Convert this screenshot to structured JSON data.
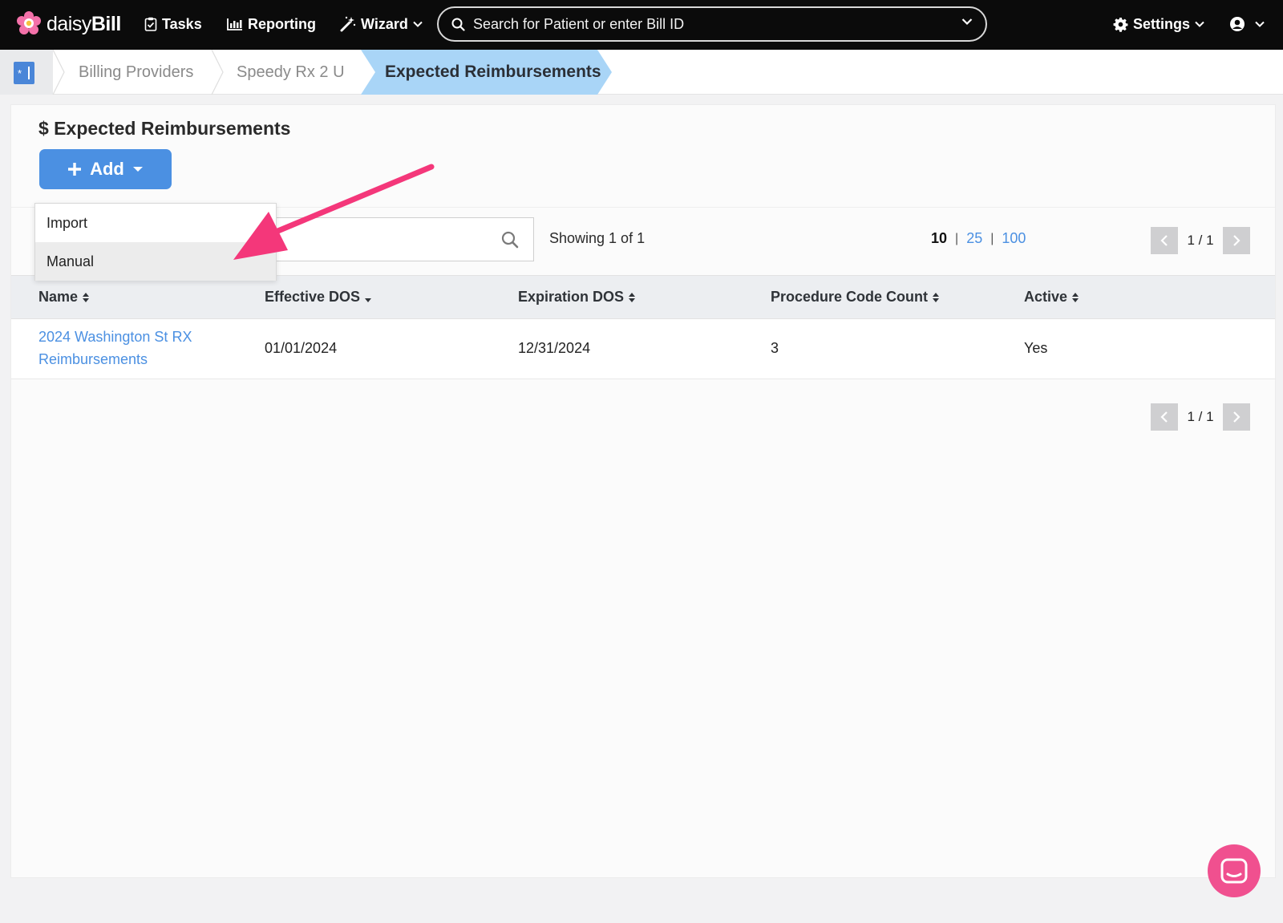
{
  "brand": {
    "logo_icon": "daisy-flower-icon",
    "name_light": "daisy",
    "name_bold": "Bill"
  },
  "nav": {
    "tasks": "Tasks",
    "reporting": "Reporting",
    "wizard": "Wizard",
    "search_placeholder": "Search for Patient or enter Bill ID",
    "settings": "Settings"
  },
  "breadcrumb": {
    "items": [
      "Billing Providers",
      "Speedy Rx 2 U"
    ],
    "current": "Expected Reimbursements"
  },
  "page": {
    "title": "$ Expected Reimbursements",
    "add_label": "Add"
  },
  "add_menu": {
    "items": [
      "Import",
      "Manual"
    ],
    "highlighted": "Manual"
  },
  "list": {
    "showing": "Showing 1 of 1",
    "page_sizes": {
      "current": "10",
      "options": [
        "25",
        "100"
      ]
    },
    "pager": "1 / 1",
    "columns": [
      "Name",
      "Effective DOS",
      "Expiration DOS",
      "Procedure Code Count",
      "Active"
    ],
    "rows": [
      {
        "name_line1": "2024 Washington St RX",
        "name_line2": "Reimbursements",
        "effective": "01/01/2024",
        "expiration": "12/31/2024",
        "count": "3",
        "active": "Yes"
      }
    ]
  },
  "colors": {
    "nav_bg": "#0b0b0b",
    "accent": "#4b90e2",
    "breadcrumb_active": "#a9d5f7",
    "annotation": "#f4377a",
    "chat": "#f0508f"
  }
}
